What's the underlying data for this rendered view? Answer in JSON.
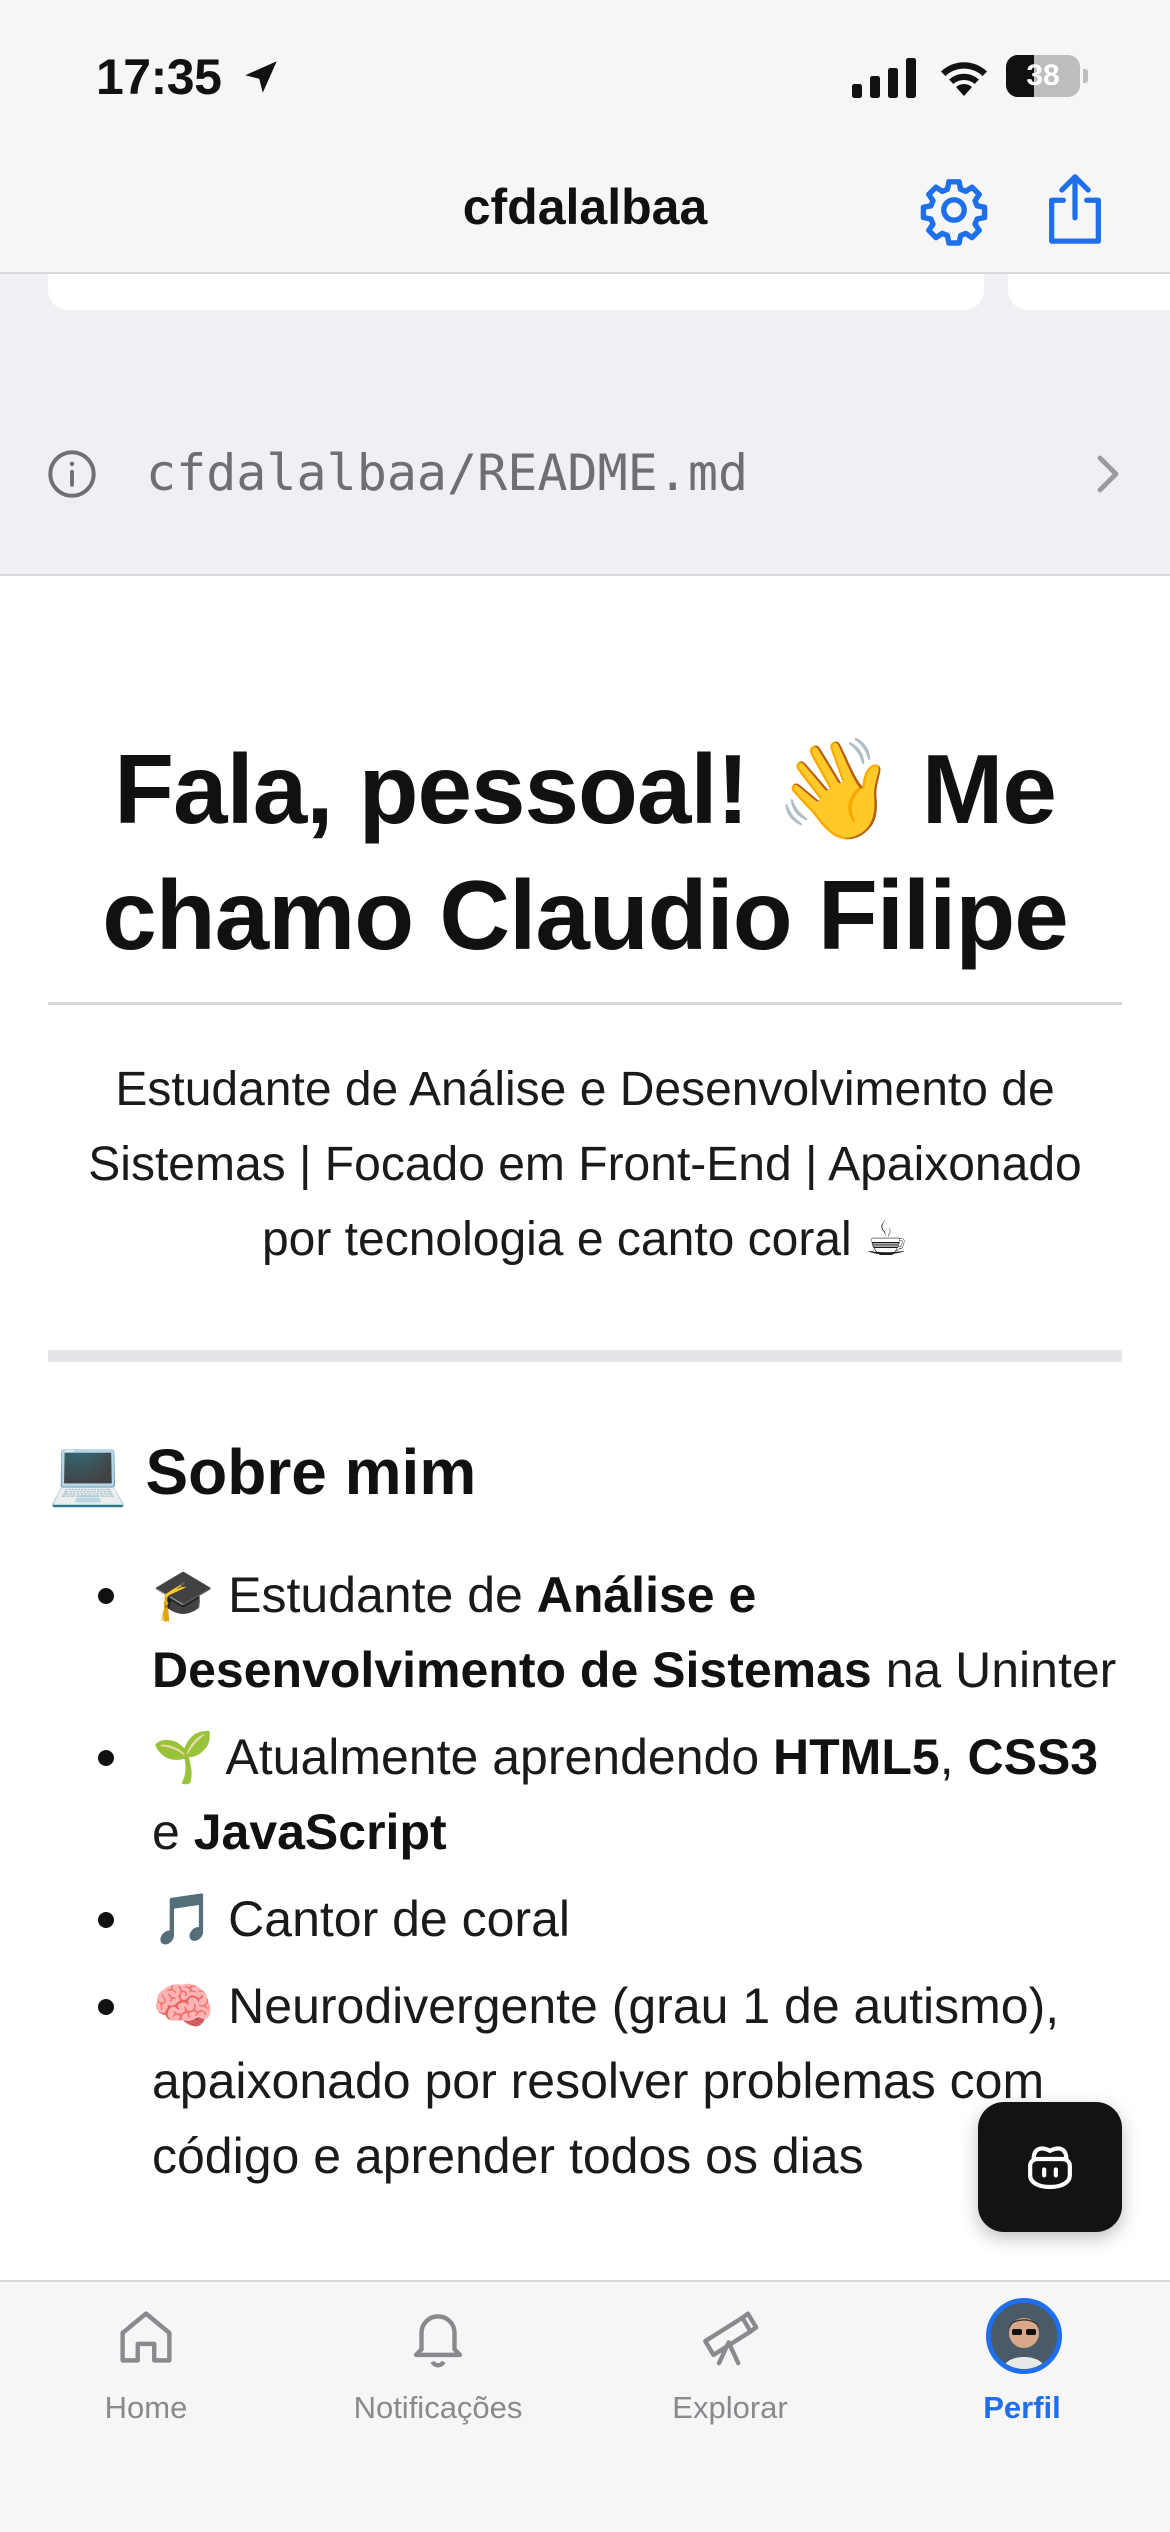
{
  "status_bar": {
    "time": "17:35",
    "battery": "38",
    "battery_level": 0.38
  },
  "header": {
    "title": "cfdalalbaa",
    "settings_icon": "gear-icon",
    "share_icon": "share-icon"
  },
  "readme_link": {
    "path": "cfdalalbaa/README.md",
    "icon": "info-icon"
  },
  "readme": {
    "h1_line1": "Fala, pessoal! 👋 Me",
    "h1_line2": "chamo Claudio Filipe",
    "tagline_line1": "Estudante de Análise e Desenvolvimento de",
    "tagline_line2": "Sistemas | Focado em Front-End | Apaixonado",
    "tagline_line3": "por tecnologia e canto coral ☕",
    "about_heading": "💻 Sobre mim",
    "about_items": [
      {
        "prefix": "🎓 Estudante de ",
        "bold": "Análise e Desenvolvimento de Sistemas",
        "suffix": " na Uninter"
      },
      {
        "prefix": "🌱 Atualmente aprendendo ",
        "bold1": "HTML5",
        "sep1": ", ",
        "bold2": "CSS3",
        "sep2": " e ",
        "bold3": "JavaScript"
      },
      {
        "text": "🎵 Cantor de coral"
      },
      {
        "text": "🧠 Neurodivergente (grau 1 de autismo), apaixonado por resolver problemas com código e aprender todos os dias"
      }
    ]
  },
  "copilot": {
    "icon": "copilot-icon"
  },
  "tabs": [
    {
      "label": "Home",
      "icon": "home-icon",
      "active": false
    },
    {
      "label": "Notificações",
      "icon": "bell-icon",
      "active": false
    },
    {
      "label": "Explorar",
      "icon": "telescope-icon",
      "active": false
    },
    {
      "label": "Perfil",
      "icon": "avatar",
      "active": true
    }
  ],
  "colors": {
    "accent": "#1f6feb",
    "bar_bg": "#f6f6f7",
    "section_bg": "#eff0f4"
  }
}
